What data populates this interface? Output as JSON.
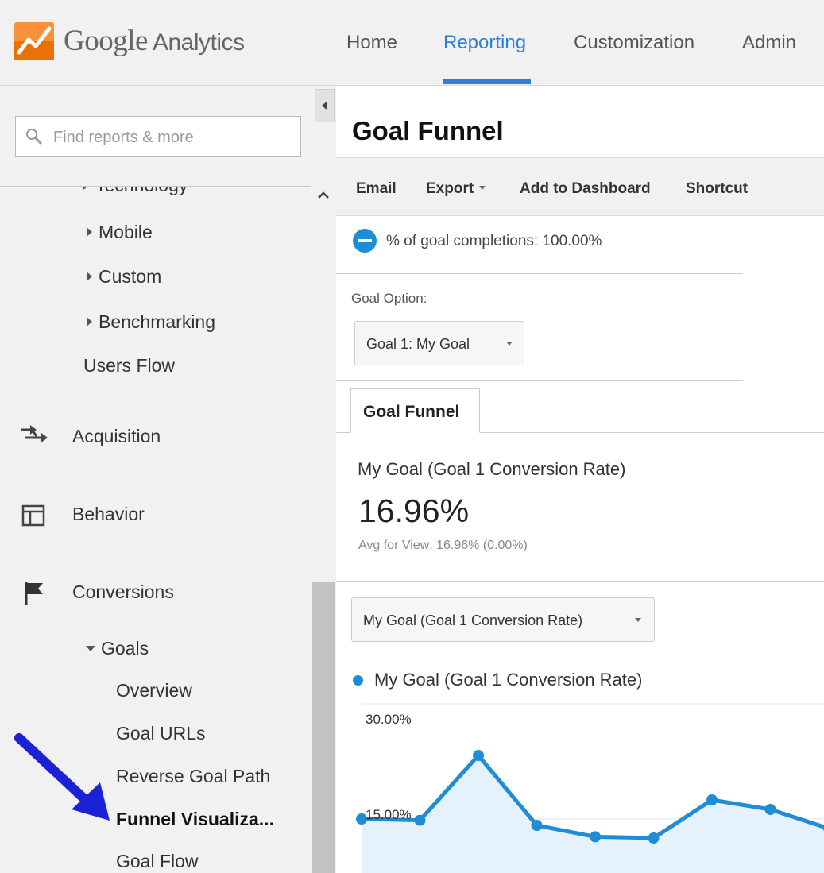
{
  "header": {
    "brand": {
      "google": "Google",
      "analytics": "Analytics"
    },
    "nav": [
      "Home",
      "Reporting",
      "Customization",
      "Admin"
    ],
    "active_nav": "Reporting",
    "accent_color": "#2f7fd6"
  },
  "sidebar": {
    "search_placeholder": "Find reports & more",
    "items": {
      "technology": "Technology",
      "mobile": "Mobile",
      "custom": "Custom",
      "benchmarking": "Benchmarking",
      "users_flow": "Users Flow",
      "acquisition": "Acquisition",
      "behavior": "Behavior",
      "conversions": "Conversions",
      "goals": "Goals",
      "overview": "Overview",
      "goal_urls": "Goal URLs",
      "reverse_goal_path": "Reverse Goal Path",
      "funnel_visualization": "Funnel Visualiza...",
      "goal_flow": "Goal Flow"
    },
    "selected_item": "Funnel Visualiza..."
  },
  "main": {
    "title": "Goal Funnel",
    "toolbar": {
      "email": "Email",
      "export": "Export",
      "add_to_dashboard": "Add to Dashboard",
      "shortcut": "Shortcut"
    },
    "segment": "% of goal completions: 100.00%",
    "goal_option_label": "Goal Option:",
    "goal_option_value": "Goal 1: My Goal",
    "tab": "Goal Funnel",
    "metric": {
      "name": "My Goal (Goal 1 Conversion Rate)",
      "value": "16.96%",
      "avg": "Avg for View: 16.96% (0.00%)"
    },
    "chart_metric_select": "My Goal (Goal 1 Conversion Rate)"
  },
  "chart_data": {
    "type": "area",
    "series": [
      {
        "name": "My Goal (Goal 1 Conversion Rate)",
        "values": [
          15.0,
          14.8,
          25.0,
          14.0,
          12.2,
          12.0,
          18.0,
          16.5,
          13.5
        ]
      }
    ],
    "y_ticks": [
      "30.00%",
      "15.00%"
    ],
    "ylim": [
      0,
      35
    ],
    "color": "#1f8dd6",
    "fill": "#e5f2fb"
  }
}
